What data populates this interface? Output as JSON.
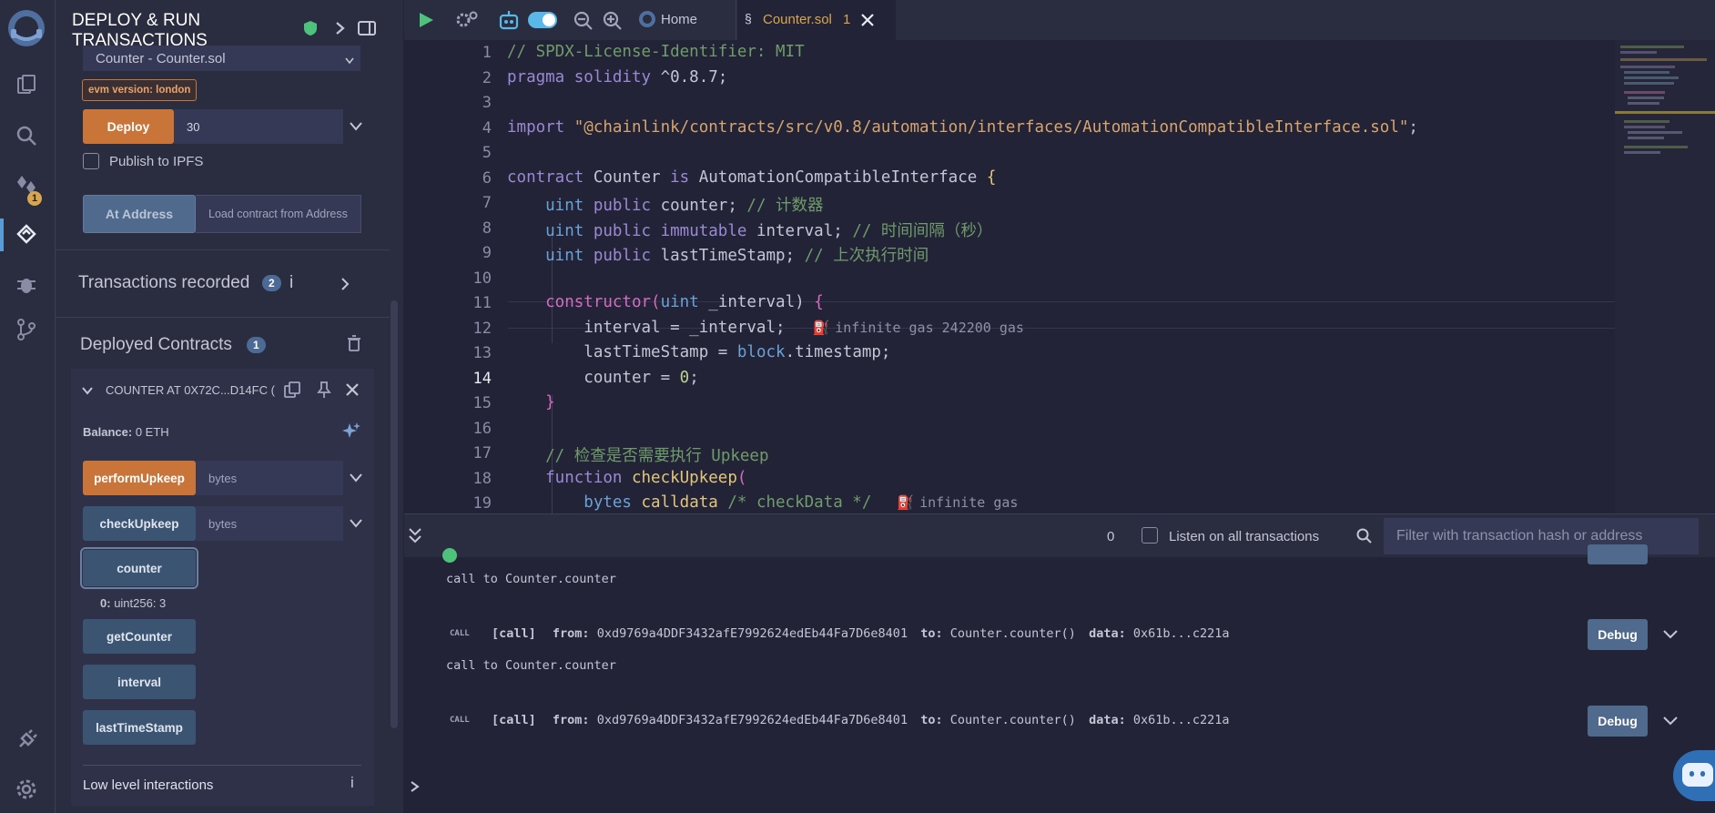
{
  "rail": {
    "plugin_badge": "1"
  },
  "panel": {
    "title_line1": "DEPLOY & RUN",
    "title_line2": "TRANSACTIONS",
    "contract_select": "Counter - Counter.sol",
    "evm_version": "evm version: london",
    "deploy_label": "Deploy",
    "deploy_value": "30",
    "publish_label": "Publish to IPFS",
    "at_address_label": "At Address",
    "at_address_placeholder": "Load contract from Address",
    "transactions_label": "Transactions recorded",
    "transactions_count": "2",
    "deployed_label": "Deployed Contracts",
    "deployed_count": "1",
    "instance_title": "COUNTER AT 0X72C...D14FC (",
    "balance_label": "Balance:",
    "balance_value": "0 ETH",
    "functions": [
      {
        "label": "performUpkeep",
        "placeholder": "bytes"
      },
      {
        "label": "checkUpkeep",
        "placeholder": "bytes"
      },
      {
        "label": "counter"
      },
      {
        "label": "getCounter"
      },
      {
        "label": "interval"
      },
      {
        "label": "lastTimeStamp"
      }
    ],
    "counter_result_key": "0:",
    "counter_result_val": "uint256: 3",
    "low_level_label": "Low level interactions"
  },
  "topbar": {
    "home_tab": "Home",
    "file_tab": "Counter.sol",
    "file_tab_count": "1"
  },
  "editor": {
    "line_numbers": [
      "1",
      "2",
      "3",
      "4",
      "5",
      "6",
      "7",
      "8",
      "9",
      "10",
      "11",
      "12",
      "13",
      "14",
      "15",
      "16",
      "17",
      "18",
      "19"
    ],
    "code": {
      "l1": "// SPDX-License-Identifier: MIT",
      "l2a": "pragma solidity ",
      "l2b": "^0.8.7;",
      "l4a": "import ",
      "l4b": "\"@chainlink/contracts/src/v0.8/automation/interfaces/AutomationCompatibleInterface.sol\"",
      "l4c": ";",
      "l6a": "contract ",
      "l6b": "Counter ",
      "l6c": "is ",
      "l6d": "AutomationCompatibleInterface ",
      "l6e": "{",
      "l7a": "    uint ",
      "l7b": "public ",
      "l7c": "counter; ",
      "l7d": "// 计数器",
      "l8a": "    uint ",
      "l8b": "public ",
      "l8c": "immutable ",
      "l8d": "interval; ",
      "l8e": "// 时间间隔（秒）",
      "l9a": "    uint ",
      "l9b": "public ",
      "l9c": "lastTimeStamp; ",
      "l9d": "// 上次执行时间",
      "l11a": "    constructor",
      "l11b": "(",
      "l11c": "uint ",
      "l11d": "_interval) ",
      "l11e": "{",
      "l12a": "        interval = _interval;",
      "l12hint": "infinite gas 242200 gas",
      "l13a": "        lastTimeStamp = ",
      "l13b": "block",
      "l13c": ".timestamp;",
      "l14a": "        counter = ",
      "l14b": "0",
      "l14c": ";",
      "l15": "    }",
      "l17": "    // 检查是否需要执行 Upkeep",
      "l18a": "    function ",
      "l18b": "checkUpkeep",
      "l18c": "(",
      "l19a": "        bytes ",
      "l19b": "calldata ",
      "l19c": "/* checkData */",
      "l19hint": "infinite gas"
    }
  },
  "terminal": {
    "pending_count": "0",
    "listen_label": "Listen on all transactions",
    "filter_placeholder": "Filter with transaction hash or address",
    "entries": [
      {
        "call_to": "call to Counter.counter"
      },
      {
        "tag": "CALL",
        "kind": "[call]",
        "from_label": "from:",
        "from": "0xd9769a4DDF3432afE7992624edEb44Fa7D6e8401",
        "to_label": "to:",
        "to": "Counter.counter()",
        "data_label": "data:",
        "data": "0x61b...c221a",
        "debug": "Debug",
        "call_to": "call to Counter.counter"
      },
      {
        "tag": "CALL",
        "kind": "[call]",
        "from_label": "from:",
        "from": "0xd9769a4DDF3432afE7992624edEb44Fa7D6e8401",
        "to_label": "to:",
        "to": "Counter.counter()",
        "data_label": "data:",
        "data": "0x61b...c221a",
        "debug": "Debug"
      }
    ]
  }
}
